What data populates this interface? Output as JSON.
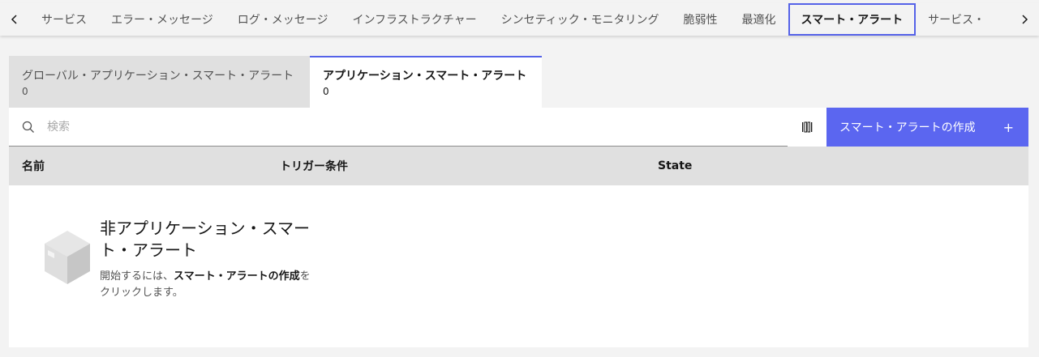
{
  "topnav": {
    "items": [
      "サービス",
      "エラー・メッセージ",
      "ログ・メッセージ",
      "インフラストラクチャー",
      "シンセティック・モニタリング",
      "脆弱性",
      "最適化",
      "スマート・アラート",
      "サービス・"
    ],
    "active_index": 7,
    "prev_icon": "chevron-left-icon",
    "next_icon": "chevron-right-icon"
  },
  "subtabs": [
    {
      "label": "グローバル・アプリケーション・スマート・アラート",
      "count": "0"
    },
    {
      "label": "アプリケーション・スマート・アラート",
      "count": "0"
    }
  ],
  "search": {
    "placeholder": "検索",
    "value": ""
  },
  "toolbar": {
    "create_label": "スマート・アラートの作成",
    "create_icon": "plus-icon",
    "columns_icon": "column-settings-icon"
  },
  "table": {
    "columns": [
      "名前",
      "トリガー条件",
      "State"
    ]
  },
  "empty_state": {
    "title": "非アプリケーション・スマート・アラート",
    "desc_prefix": "開始するには、",
    "desc_bold": "スマート・アラートの作成",
    "desc_suffix": "をクリックします。",
    "icon": "empty-box-icon"
  },
  "colors": {
    "accent": "#5b66f0",
    "active_border": "#5562e8"
  }
}
